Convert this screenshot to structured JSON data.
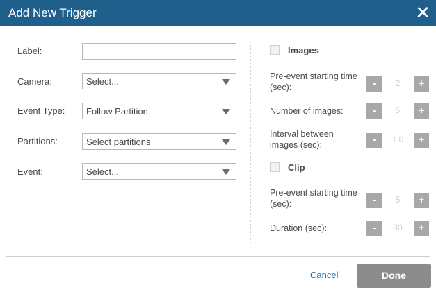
{
  "dialog": {
    "title": "Add New Trigger",
    "close_symbol": "✕"
  },
  "form": {
    "label": {
      "label": "Label:",
      "value": ""
    },
    "camera": {
      "label": "Camera:",
      "value": "Select..."
    },
    "event_type": {
      "label": "Event Type:",
      "value": "Follow Partition"
    },
    "partitions": {
      "label": "Partitions:",
      "value": "Select partitions"
    },
    "event": {
      "label": "Event:",
      "value": "Select..."
    }
  },
  "images": {
    "title": "Images",
    "checked": false,
    "pre_event": {
      "label": "Pre-event starting time (sec):",
      "value": "2"
    },
    "count": {
      "label": "Number of images:",
      "value": "5"
    },
    "interval": {
      "label": "Interval between images (sec):",
      "value": "1.0"
    }
  },
  "clip": {
    "title": "Clip",
    "checked": false,
    "pre_event": {
      "label": "Pre-event starting time (sec):",
      "value": "5"
    },
    "duration": {
      "label": "Duration (sec):",
      "value": "30"
    }
  },
  "stepper": {
    "minus": "-",
    "plus": "+"
  },
  "footer": {
    "cancel": "Cancel",
    "done": "Done"
  },
  "colors": {
    "header": "#1f5f8b",
    "stepper_button": "#a8a8a8",
    "done_button": "#8c8c8c",
    "link": "#2a6ea6"
  }
}
